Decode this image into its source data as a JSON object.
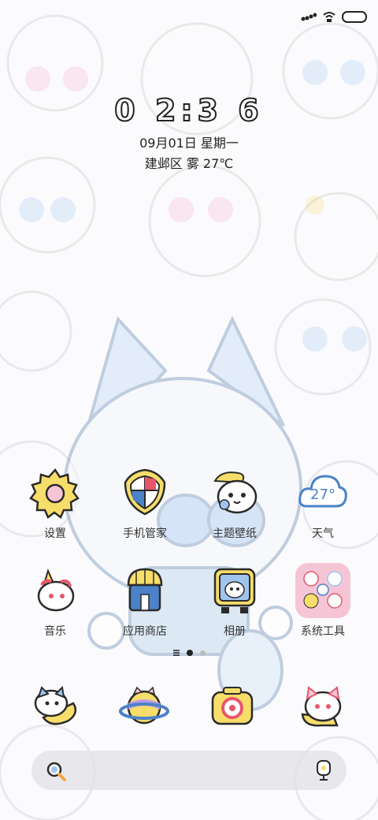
{
  "status_bar": {
    "signal_icon": "signal-icon",
    "wifi_icon": "wifi-icon",
    "battery_icon": "battery-icon"
  },
  "lockscreen_clock": {
    "time": "0 2:3 6",
    "date": "09月01日 星期一",
    "location_weather": "建邺区 雾 27℃"
  },
  "apps_row1": [
    {
      "label": "设置",
      "icon": "settings-gear-icon"
    },
    {
      "label": "手机管家",
      "icon": "shield-icon"
    },
    {
      "label": "主题壁纸",
      "icon": "theme-cat-icon"
    },
    {
      "label": "天气",
      "icon": "weather-cloud-icon",
      "badge": "27°"
    }
  ],
  "apps_row2": [
    {
      "label": "音乐",
      "icon": "music-icon"
    },
    {
      "label": "应用商店",
      "icon": "app-store-icon"
    },
    {
      "label": "相册",
      "icon": "gallery-icon"
    },
    {
      "label": "系统工具",
      "icon": "folder-icon"
    }
  ],
  "page_indicator": {
    "pages": 3,
    "current": 2
  },
  "dock": [
    {
      "icon": "phone-cat-icon"
    },
    {
      "icon": "planet-icon"
    },
    {
      "icon": "camera-icon"
    },
    {
      "icon": "messages-cat-icon"
    }
  ],
  "search_bar": {
    "search_icon": "search-icon",
    "assistant_icon": "voice-assistant-icon"
  },
  "colors": {
    "accent_blue": "#4c82c8",
    "outline": "#2b2b2b",
    "yellow": "#f7dd6a",
    "pink": "#f2a7c1"
  }
}
